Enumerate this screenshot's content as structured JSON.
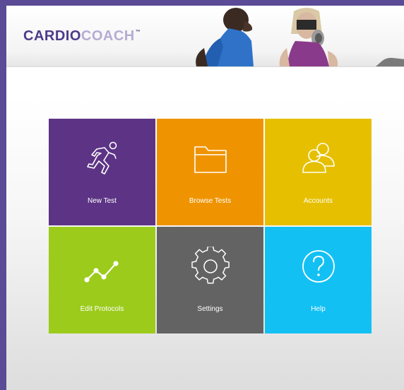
{
  "app": {
    "brand_part1": "CARDIO",
    "brand_part2": "COACH",
    "brand_mark": "™"
  },
  "menu": {
    "tiles": [
      {
        "label": "New Test",
        "icon": "running-person-icon",
        "color": "#5d3485"
      },
      {
        "label": "Browse Tests",
        "icon": "folder-icon",
        "color": "#ef9400"
      },
      {
        "label": "Accounts",
        "icon": "users-icon",
        "color": "#e6c000"
      },
      {
        "label": "Edit Protocols",
        "icon": "line-graph-icon",
        "color": "#9ccb1c"
      },
      {
        "label": "Settings",
        "icon": "gear-icon",
        "color": "#636363"
      },
      {
        "label": "Help",
        "icon": "question-circle-icon",
        "color": "#13c0f4"
      }
    ]
  },
  "colors": {
    "frame": "#5b4a96",
    "brand_dark": "#4d3a8b",
    "brand_light": "#b5acd3"
  }
}
